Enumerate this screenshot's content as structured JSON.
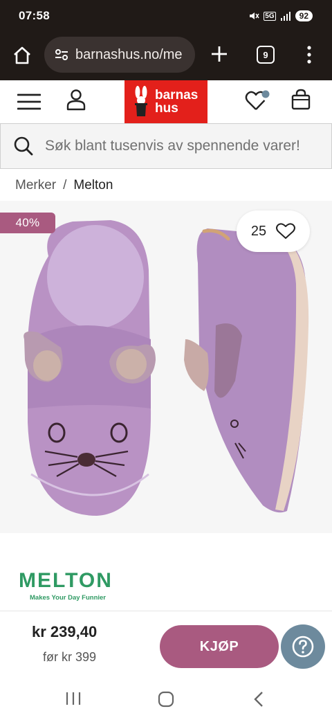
{
  "status_bar": {
    "time": "07:58",
    "network": "5G",
    "battery": "92"
  },
  "browser": {
    "url": "barnashus.no/me",
    "tab_count": "9"
  },
  "site": {
    "logo_line1": "barnas",
    "logo_line2": "hus",
    "logo_color": "#e3201b"
  },
  "search": {
    "placeholder": "Søk blant tusenvis av spennende varer!"
  },
  "breadcrumb": {
    "items": [
      "Merker",
      "Melton"
    ],
    "separator": "/"
  },
  "product": {
    "discount": "40%",
    "likes": "25",
    "brand": {
      "name": "MELTON",
      "tagline": "Makes Your Day Funnier"
    },
    "price_now": "kr 239,40",
    "price_before": "før kr 399",
    "buy_label": "KJØP"
  },
  "colors": {
    "accent": "#a95a80",
    "help": "#6d8a9d",
    "brand_green": "#2f9a63"
  },
  "icons": [
    "home-icon",
    "tune-icon",
    "plus-icon",
    "tabs-icon",
    "more-icon",
    "hamburger-icon",
    "user-icon",
    "heart-icon",
    "bag-icon",
    "search-icon",
    "help-icon",
    "recent-apps-icon",
    "nav-home-icon",
    "back-icon"
  ]
}
